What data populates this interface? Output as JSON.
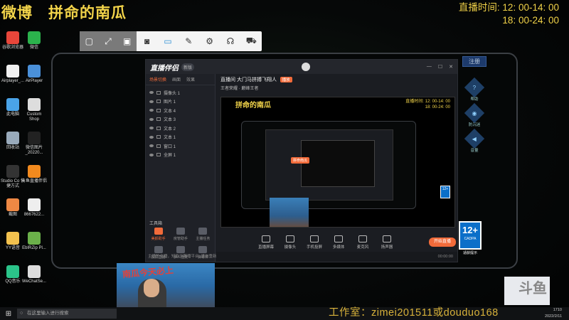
{
  "overlay": {
    "title_left": "微博",
    "title_right": "拼命的南瓜",
    "clock_label": "直播时间:",
    "clock_start": "12: 00-14: 00",
    "clock_end": "18: 00-24: 00"
  },
  "desktop_icons": [
    {
      "label": "谷歌浏览器",
      "color": "#e8463a"
    },
    {
      "label": "微信",
      "color": "#2bb24c"
    },
    {
      "label": "Airplayer_...",
      "color": "#f0f0f0"
    },
    {
      "label": "AirPlayer",
      "color": "#4a90d9"
    },
    {
      "label": "此电脑",
      "color": "#4aa3e8"
    },
    {
      "label": "Custom Shop",
      "color": "#dddddd"
    },
    {
      "label": "回收站",
      "color": "#9ab"
    },
    {
      "label": "微信图片_20220...",
      "color": "#222"
    },
    {
      "label": "Studio Co 快捷方式",
      "color": "#333"
    },
    {
      "label": "斗鱼直播伴侣",
      "color": "#f28a1e"
    },
    {
      "label": "截图",
      "color": "#e84"
    },
    {
      "label": "8667622...",
      "color": "#eee"
    },
    {
      "label": "YY语音",
      "color": "#f2c14e"
    },
    {
      "label": "EbIRZip Pl...",
      "color": "#6bb04a"
    },
    {
      "label": "QQ音乐",
      "color": "#2bc48a"
    },
    {
      "label": "WeChatSe...",
      "color": "#ddd"
    }
  ],
  "float_toolbar": {
    "icons": [
      "camera-icon",
      "screen-icon",
      "pen-icon",
      "settings-icon",
      "headset-icon",
      "cart-icon"
    ]
  },
  "app": {
    "logo": "直播伴侣",
    "version": "新版",
    "window_controls": [
      "—",
      "☐",
      "✕"
    ],
    "side_tabs": [
      "场景切换",
      "画面",
      "效果"
    ],
    "layers": [
      "摄像头 1",
      "图片 1",
      "文本 4",
      "文本 3",
      "文本 2",
      "文本 1",
      "窗口 1",
      "全屏 1"
    ],
    "tools_title": "工具箱",
    "tools": [
      {
        "label": "美颜助手",
        "hot": true
      },
      {
        "label": "房管助手",
        "hot": false
      },
      {
        "label": "主播任务",
        "hot": false
      },
      {
        "label": "投屏直播",
        "hot": false
      },
      {
        "label": "多人连麦",
        "hot": false
      },
      {
        "label": "弹幕库",
        "hot": false
      },
      {
        "label": "虚拟形象",
        "hot": false
      },
      {
        "label": "弹幕姬",
        "hot": false
      },
      {
        "label": "数据助手",
        "hot": false
      },
      {
        "label": "更多",
        "hot": false
      }
    ],
    "side_tip": "主播的主播，知能天鹅播平台, 请勿重新发布等内容",
    "room_title": "直播间 大门马拼搏飞翔人",
    "room_badge": "播放",
    "room_meta": "王者荣耀 · 巅峰王者",
    "bottom_tools": [
      "直播屏幕",
      "摄像头",
      "手机投屏",
      "多媒体",
      "麦克风",
      "扬声器"
    ],
    "start_button": "开始直播",
    "status_time": "00:00:00",
    "orange_tag": "拼命南瓜"
  },
  "right_panel": {
    "login": "注册",
    "widgets": [
      {
        "icon": "?",
        "label": "帮助"
      },
      {
        "icon": "◉",
        "label": "防沉迷"
      },
      {
        "icon": "◀",
        "label": "音量"
      }
    ],
    "age_rating": "12+",
    "age_label": "CADPA",
    "age_foot": "适龄提示"
  },
  "webcam": {
    "banner": "南瓜今天必上"
  },
  "taskbar": {
    "search_placeholder": "在这里输入进行搜索",
    "tray_time": "1710",
    "tray_date": "2022/2/11"
  },
  "studio_text": "工作室：zimei201511或douduo168",
  "brand_text": "斗鱼"
}
